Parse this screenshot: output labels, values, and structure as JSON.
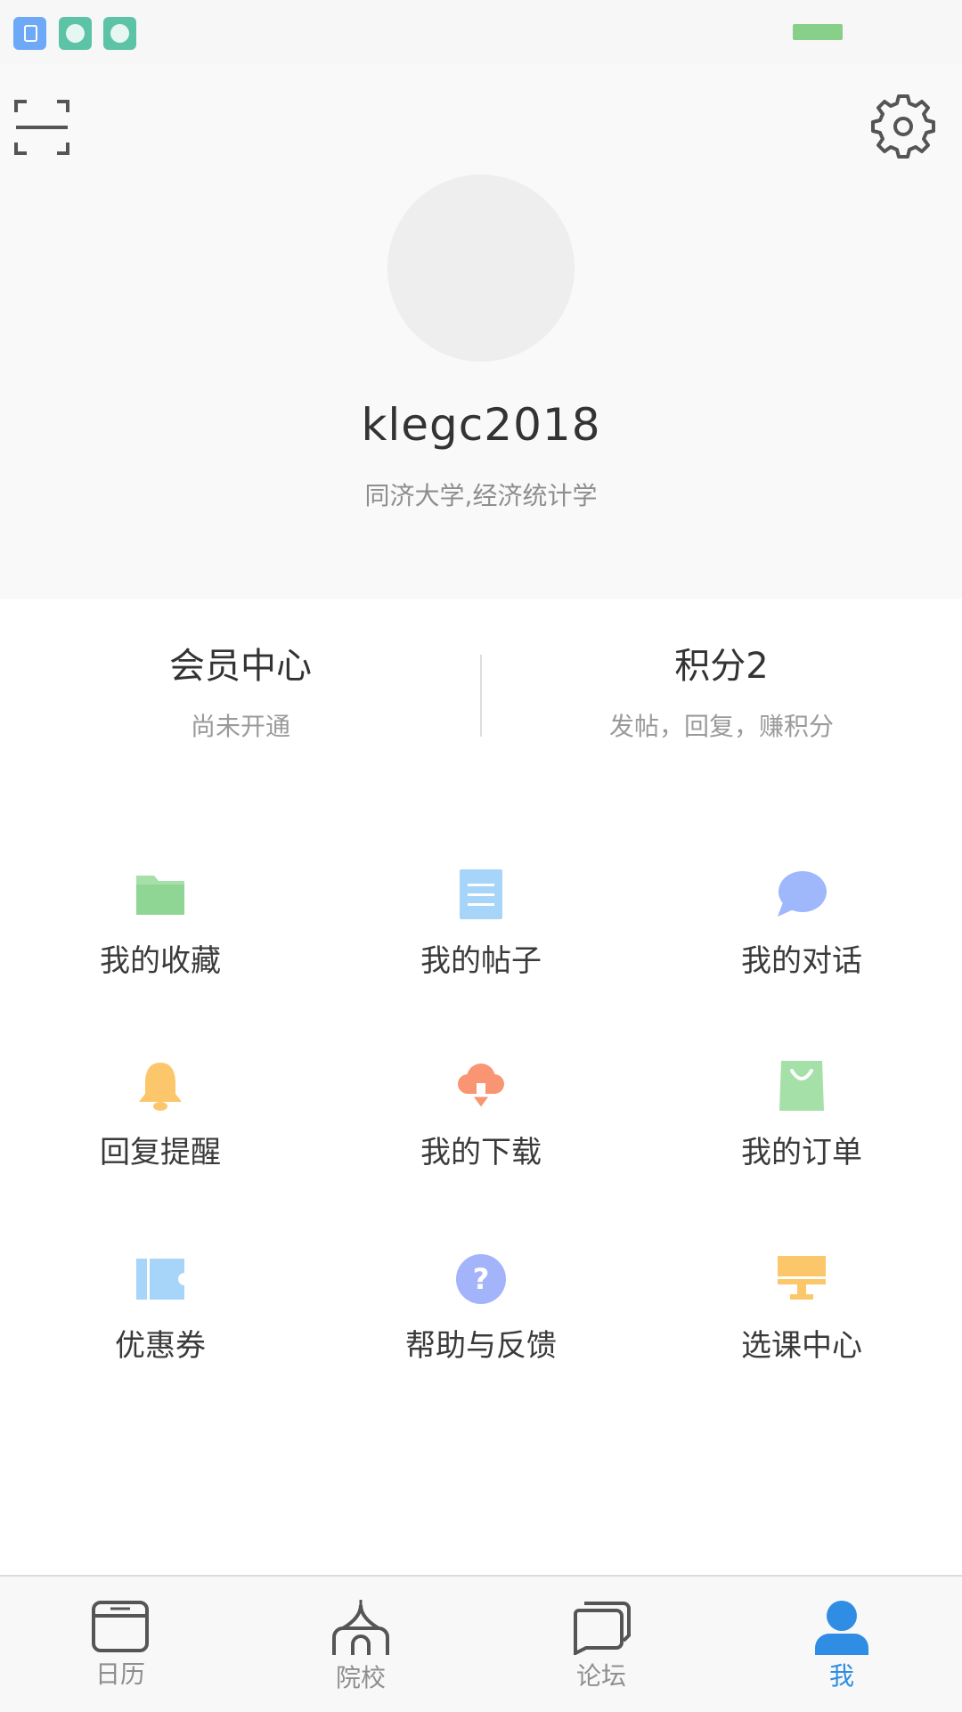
{
  "profile": {
    "username": "klegc2018",
    "school_major": "同济大学,经济统计学"
  },
  "stats": {
    "membership": {
      "title": "会员中心",
      "subtitle": "尚未开通"
    },
    "points": {
      "title": "积分2",
      "subtitle": "发帖，回复，赚积分"
    }
  },
  "menu": [
    {
      "label": "我的收藏",
      "icon": "folder-icon",
      "color": "#a6e0a9"
    },
    {
      "label": "我的帖子",
      "icon": "document-icon",
      "color": "#a7d4f9"
    },
    {
      "label": "我的对话",
      "icon": "chat-bubble-icon",
      "color": "#9fb7fb"
    },
    {
      "label": "回复提醒",
      "icon": "bell-icon",
      "color": "#fcc66b"
    },
    {
      "label": "我的下载",
      "icon": "cloud-download-icon",
      "color": "#fa9573"
    },
    {
      "label": "我的订单",
      "icon": "shopping-bag-icon",
      "color": "#a6e0a9"
    },
    {
      "label": "优惠券",
      "icon": "ticket-icon",
      "color": "#a7d4f9"
    },
    {
      "label": "帮助与反馈",
      "icon": "help-icon",
      "color": "#a3b4fb"
    },
    {
      "label": "选课中心",
      "icon": "monitor-icon",
      "color": "#fcc66b"
    }
  ],
  "tabs": [
    {
      "label": "日历",
      "icon": "calendar-icon",
      "active": false
    },
    {
      "label": "院校",
      "icon": "school-icon",
      "active": false
    },
    {
      "label": "论坛",
      "icon": "forum-icon",
      "active": false
    },
    {
      "label": "我",
      "icon": "person-icon",
      "active": true
    }
  ],
  "colors": {
    "accent": "#2f8de4",
    "header_bg": "#f9f9f9",
    "tab_inactive": "#8f8f8f"
  }
}
